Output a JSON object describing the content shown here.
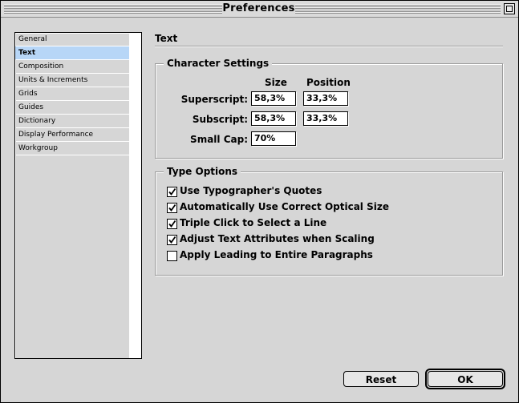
{
  "window": {
    "title": "Preferences"
  },
  "sidebar": {
    "items": [
      {
        "label": "General"
      },
      {
        "label": "Text"
      },
      {
        "label": "Composition"
      },
      {
        "label": "Units & Increments"
      },
      {
        "label": "Grids"
      },
      {
        "label": "Guides"
      },
      {
        "label": "Dictionary"
      },
      {
        "label": "Display Performance"
      },
      {
        "label": "Workgroup"
      }
    ],
    "selected": "Text"
  },
  "panel": {
    "title": "Text",
    "character_settings": {
      "label": "Character Settings",
      "col_size": "Size",
      "col_position": "Position",
      "superscript": {
        "label": "Superscript:",
        "size": "58,3%",
        "position": "33,3%"
      },
      "subscript": {
        "label": "Subscript:",
        "size": "58,3%",
        "position": "33,3%"
      },
      "small_cap": {
        "label": "Small Cap:",
        "size": "70%"
      }
    },
    "type_options": {
      "label": "Type Options",
      "options": [
        {
          "label": "Use Typographer's Quotes",
          "checked": true
        },
        {
          "label": "Automatically Use Correct Optical Size",
          "checked": true
        },
        {
          "label": "Triple Click to Select a Line",
          "checked": true
        },
        {
          "label": "Adjust Text Attributes when Scaling",
          "checked": true
        },
        {
          "label": "Apply Leading to Entire Paragraphs",
          "checked": false
        }
      ]
    }
  },
  "buttons": {
    "reset": "Reset",
    "ok": "OK"
  }
}
